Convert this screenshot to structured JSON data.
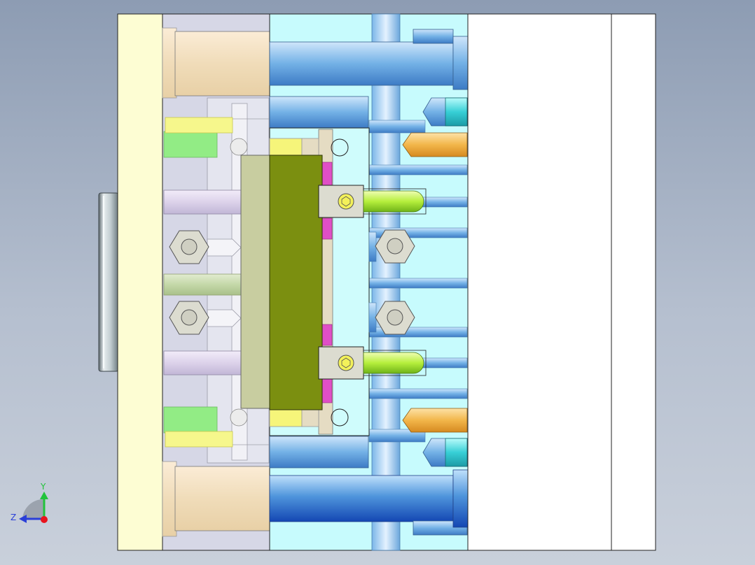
{
  "viewport": {
    "background_top": "#8d9cb3",
    "background_bottom": "#c9d0db"
  },
  "model": {
    "plates": [
      {
        "name": "clamp-plate",
        "color": "#fdfdd3"
      },
      {
        "name": "spacer-block",
        "color": "#d5d6e6"
      },
      {
        "name": "b-plate",
        "color": "#c7fbfd"
      },
      {
        "name": "a-plate",
        "color": "#ffffff"
      },
      {
        "name": "top-clamp-plate",
        "color": "#ffffff"
      }
    ],
    "parts": {
      "core": "#7b8f10",
      "ejector-retainer": "#c8cda0",
      "guide-pin": "#6aa8df",
      "return-pin": "#f0b44a",
      "sprue-pin": "#3fd1d8",
      "slider-pin": "#b6ef3c",
      "spring": "#92ec85",
      "lifter-pad": "#f6f57a",
      "insert": "#e04fc6",
      "bolt-head": "#d9d9cc",
      "support-pillar": "#f3dfc0",
      "locating-ring": "#cfd8da"
    }
  },
  "triad": {
    "y_label": "Y",
    "z_label": "Z",
    "y_color": "#22c33b",
    "z_color": "#2a3fd8",
    "x_color": "#e8131d"
  }
}
